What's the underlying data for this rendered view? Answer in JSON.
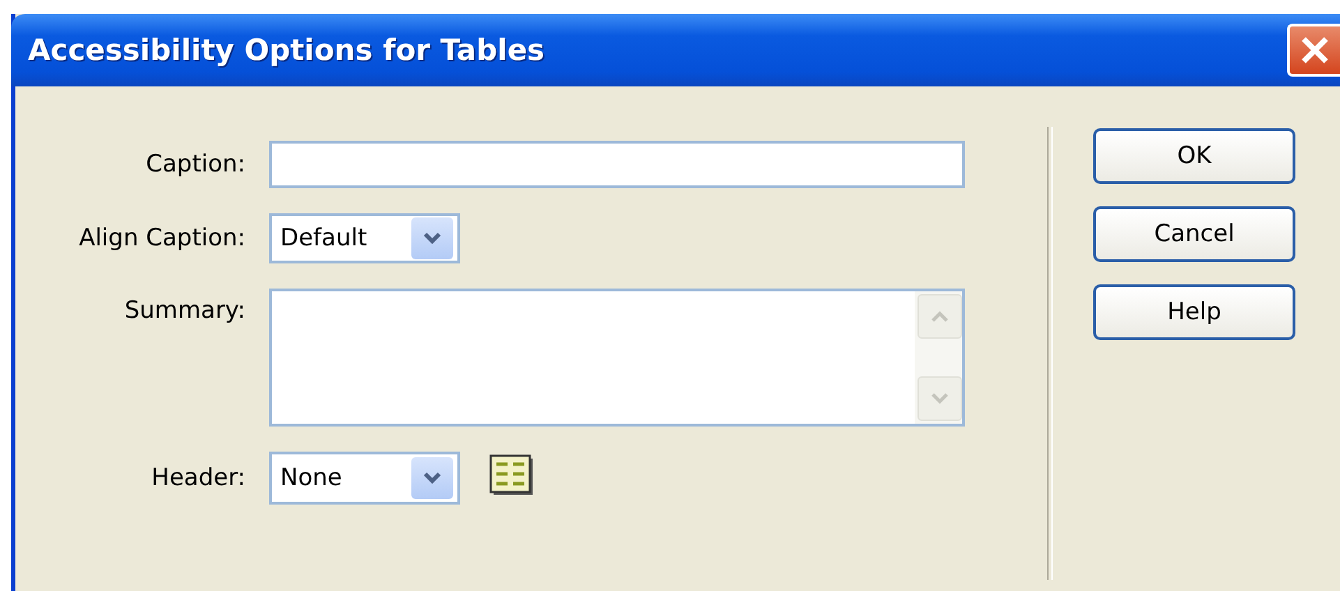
{
  "window": {
    "title": "Accessibility Options for Tables"
  },
  "fields": [
    {
      "kind": "text",
      "label": "Caption:"
    },
    {
      "kind": "select",
      "label": "Align Caption:",
      "value": "Default"
    },
    {
      "kind": "textarea",
      "label": "Summary:"
    },
    {
      "kind": "select-icon",
      "label": "Header:",
      "value": "None"
    }
  ],
  "buttons": [
    "OK",
    "Cancel",
    "Help"
  ]
}
